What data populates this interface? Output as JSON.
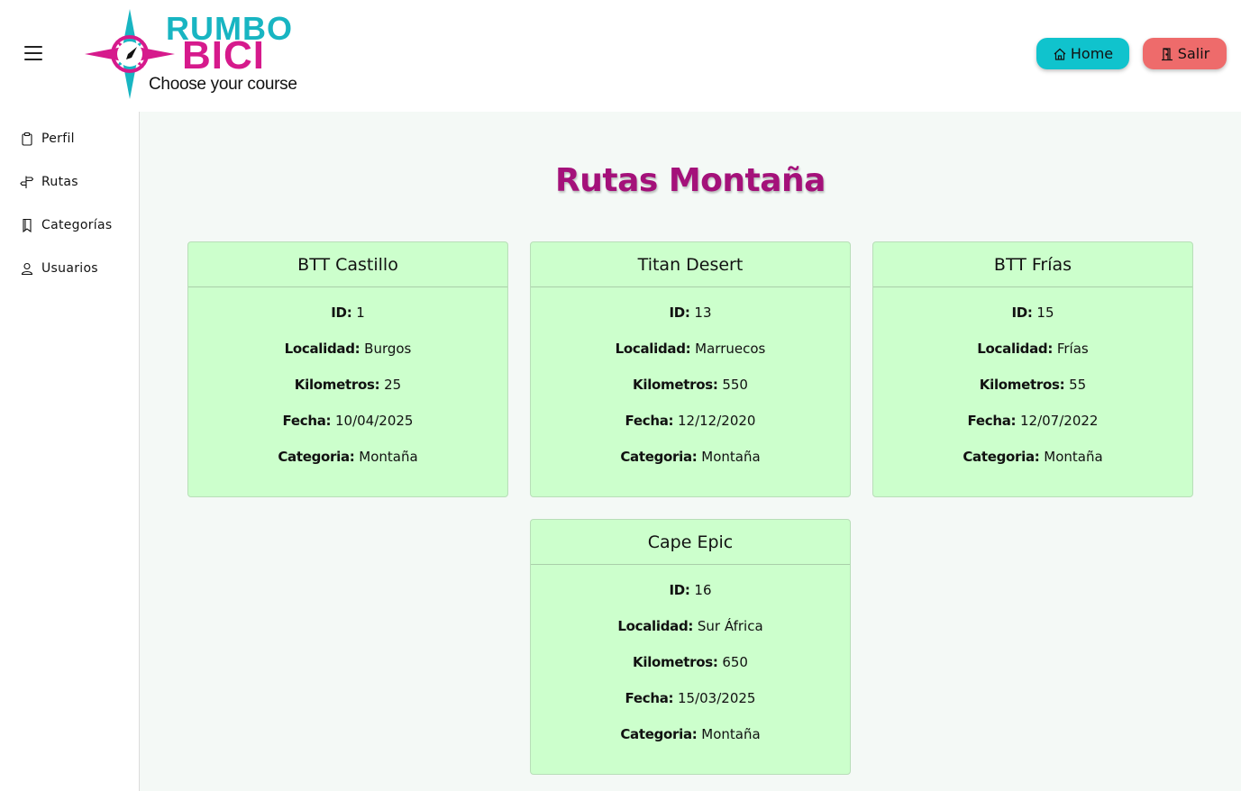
{
  "header": {
    "logo": {
      "line1": "RUMBO",
      "line2": "BICI",
      "tagline": "Choose your course"
    },
    "home_label": "Home",
    "salir_label": "Salir",
    "colors": {
      "home": "#10c3cd",
      "salir": "#ee6b6b",
      "logo_cyan": "#18b5c2",
      "logo_magenta": "#d61a8c"
    }
  },
  "sidebar": {
    "items": [
      {
        "label": "Perfil",
        "icon": "clipboard-icon"
      },
      {
        "label": "Rutas",
        "icon": "signpost-icon"
      },
      {
        "label": "Categorías",
        "icon": "bookmark-icon"
      },
      {
        "label": "Usuarios",
        "icon": "user-icon"
      }
    ]
  },
  "main": {
    "title": "Rutas Montaña",
    "labels": {
      "id": "ID:",
      "localidad": "Localidad:",
      "kilometros": "Kilometros:",
      "fecha": "Fecha:",
      "categoria": "Categoria:"
    },
    "routes": [
      {
        "name": "BTT Castillo",
        "id": "1",
        "localidad": "Burgos",
        "kilometros": "25",
        "fecha": "10/04/2025",
        "categoria": "Montaña"
      },
      {
        "name": "Titan Desert",
        "id": "13",
        "localidad": "Marruecos",
        "kilometros": "550",
        "fecha": "12/12/2020",
        "categoria": "Montaña"
      },
      {
        "name": "BTT Frías",
        "id": "15",
        "localidad": "Frías",
        "kilometros": "55",
        "fecha": "12/07/2022",
        "categoria": "Montaña"
      },
      {
        "name": "Cape Epic",
        "id": "16",
        "localidad": "Sur África",
        "kilometros": "650",
        "fecha": "15/03/2025",
        "categoria": "Montaña"
      }
    ]
  }
}
